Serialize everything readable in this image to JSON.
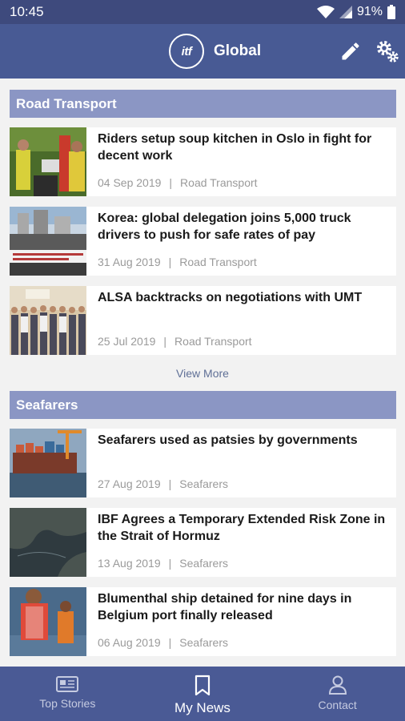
{
  "status": {
    "time": "10:45",
    "battery": "91%"
  },
  "header": {
    "logo_text": "itf",
    "title": "Global"
  },
  "sections": [
    {
      "title": "Road Transport",
      "articles": [
        {
          "title": "Riders setup soup kitchen in Oslo in fight for decent work",
          "date": "04 Sep 2019",
          "category": "Road Transport"
        },
        {
          "title": "Korea: global delegation joins 5,000 truck drivers to push for safe rates of pay",
          "date": "31 Aug 2019",
          "category": "Road Transport"
        },
        {
          "title": "ALSA backtracks on negotiations with UMT",
          "date": "25 Jul 2019",
          "category": "Road Transport"
        }
      ],
      "view_more": "View More"
    },
    {
      "title": "Seafarers",
      "articles": [
        {
          "title": "Seafarers used as patsies by governments",
          "date": "27 Aug 2019",
          "category": "Seafarers"
        },
        {
          "title": "IBF Agrees a Temporary Extended Risk Zone in the Strait of Hormuz",
          "date": "13 Aug 2019",
          "category": "Seafarers"
        },
        {
          "title": "Blumenthal ship detained for nine days in Belgium port finally released",
          "date": "06 Aug 2019",
          "category": "Seafarers"
        }
      ]
    }
  ],
  "meta_separator": "|",
  "nav": {
    "items": [
      {
        "label": "Top Stories",
        "icon": "newspaper-icon"
      },
      {
        "label": "My News",
        "icon": "bookmark-icon",
        "active": true
      },
      {
        "label": "Contact",
        "icon": "person-icon"
      }
    ]
  }
}
